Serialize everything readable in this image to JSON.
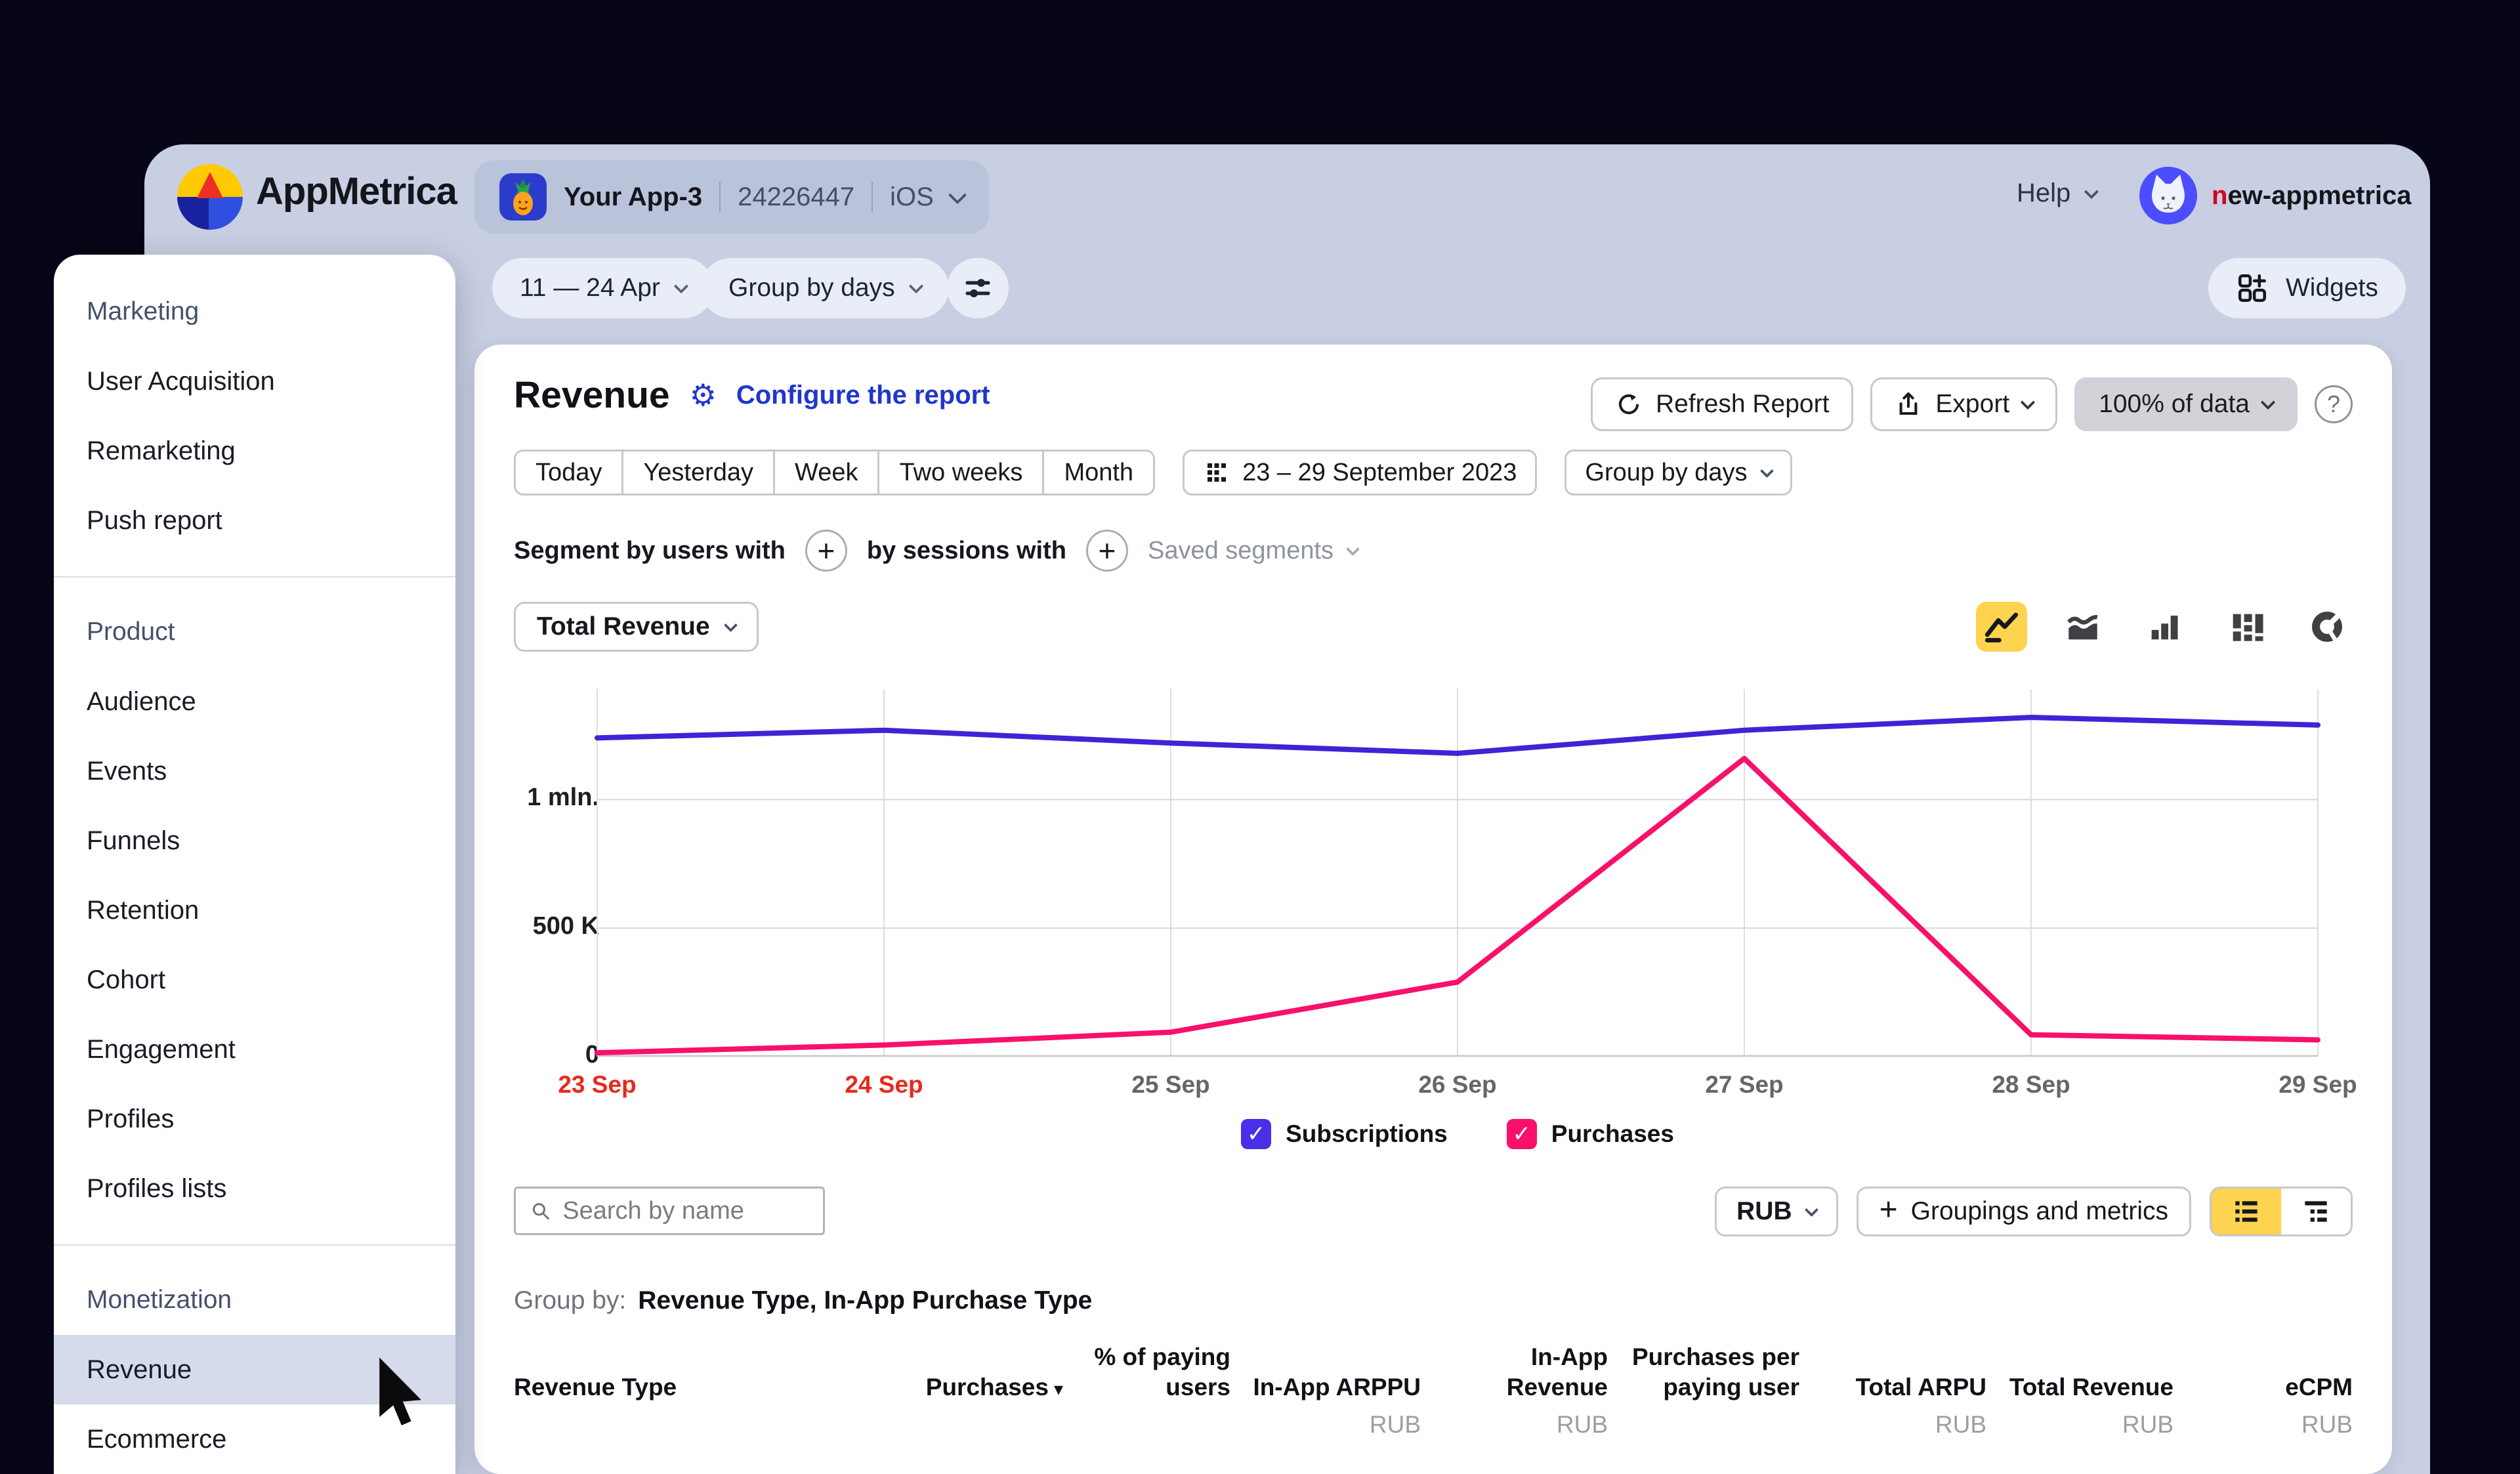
{
  "colors": {
    "canvas_bg": "#060515",
    "window_bg": "#c8cfe2",
    "card_bg": "#ffffff",
    "accent_blue": "#2136cb",
    "selected_yellow": "#fdd34f",
    "red_axis_label": "#e8291c",
    "sidebar_selected_bg": "#d5dbeb"
  },
  "header": {
    "brand": "AppMetrica",
    "app_name": "Your App-3",
    "app_id": "24226447",
    "platform": "iOS",
    "help_label": "Help",
    "account_name": "new-appmetrica"
  },
  "toolbar": {
    "date_range": "11 — 24 Apr",
    "grouping": "Group by days",
    "widgets_label": "Widgets"
  },
  "sidebar": {
    "sections": [
      {
        "title": "Marketing",
        "items": [
          {
            "label": "User Acquisition"
          },
          {
            "label": "Remarketing"
          },
          {
            "label": "Push report"
          }
        ]
      },
      {
        "title": "Product",
        "items": [
          {
            "label": "Audience"
          },
          {
            "label": "Events"
          },
          {
            "label": "Funnels"
          },
          {
            "label": "Retention"
          },
          {
            "label": "Cohort"
          },
          {
            "label": "Engagement"
          },
          {
            "label": "Profiles"
          },
          {
            "label": "Profiles lists"
          }
        ]
      },
      {
        "title": "Monetization",
        "items": [
          {
            "label": "Revenue",
            "selected": true
          },
          {
            "label": "Ecommerce"
          }
        ]
      }
    ]
  },
  "report": {
    "title": "Revenue",
    "configure_label": "Configure the report",
    "refresh_label": "Refresh Report",
    "export_label": "Export",
    "sampling_label": "100% of data",
    "range_buttons": [
      "Today",
      "Yesterday",
      "Week",
      "Two weeks",
      "Month"
    ],
    "calendar_range": "23 – 29 September 2023",
    "grouping": "Group by days",
    "segment_users_label": "Segment by users with",
    "segment_sessions_label": "by sessions with",
    "saved_segments_label": "Saved segments",
    "metric_selector": "Total Revenue"
  },
  "chart_data": {
    "type": "line",
    "x": [
      "23 Sep",
      "24 Sep",
      "25 Sep",
      "26 Sep",
      "27 Sep",
      "28 Sep",
      "29 Sep"
    ],
    "x_label_colors": [
      "#e8291c",
      "#e8291c",
      "#666666",
      "#666666",
      "#666666",
      "#666666",
      "#666666"
    ],
    "series": [
      {
        "name": "Subscriptions",
        "color": "#3e24d6",
        "values": [
          1240000,
          1270000,
          1220000,
          1180000,
          1270000,
          1320000,
          1290000
        ]
      },
      {
        "name": "Purchases",
        "color": "#f8106b",
        "values": [
          15000,
          45000,
          95000,
          290000,
          1160000,
          85000,
          65000
        ]
      }
    ],
    "y_ticks": [
      {
        "label": "0",
        "value": 0
      },
      {
        "label": "500 K",
        "value": 500000
      },
      {
        "label": "1 mln.",
        "value": 1000000
      }
    ],
    "ylim": [
      0,
      1430000
    ],
    "grid": true,
    "legend_position": "bottom"
  },
  "legend": [
    {
      "label": "Subscriptions",
      "color": "#4a2fe8",
      "checked": true
    },
    {
      "label": "Purchases",
      "color": "#f8106b",
      "checked": true
    }
  ],
  "controls": {
    "search_placeholder": "Search by name",
    "currency": "RUB",
    "groupings_label": "Groupings and metrics"
  },
  "table": {
    "group_by_label": "Group by:",
    "group_by_value": "Revenue Type, In-App Purchase Type",
    "columns": [
      {
        "label": "Revenue Type",
        "align": "left"
      },
      {
        "label": "Purchases",
        "sort": "desc"
      },
      {
        "label": "% of paying users",
        "narrow": 220
      },
      {
        "label": "In-App ARPPU",
        "unit": "RUB"
      },
      {
        "label": "In-App Revenue",
        "unit": "RUB",
        "narrow": 175
      },
      {
        "label": "Purchases per paying user",
        "narrow": 275
      },
      {
        "label": "Total ARPU",
        "unit": "RUB"
      },
      {
        "label": "Total Revenue",
        "unit": "RUB"
      },
      {
        "label": "eCPM",
        "unit": "RUB"
      }
    ]
  }
}
